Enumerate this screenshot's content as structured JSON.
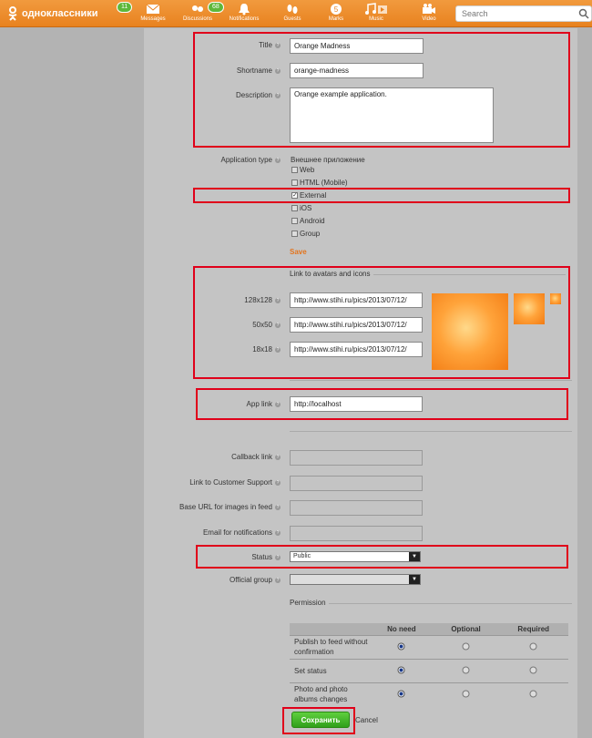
{
  "header": {
    "logo": "одноклассники",
    "logo_badge": "11",
    "nav": [
      {
        "label": "Messages",
        "icon": "envelope-icon"
      },
      {
        "label": "Discussions",
        "icon": "discussions-icon",
        "badge": "68"
      },
      {
        "label": "Notifications",
        "icon": "bell-icon"
      },
      {
        "label": "Guests",
        "icon": "footprints-icon"
      },
      {
        "label": "Marks",
        "icon": "marks-icon"
      },
      {
        "label": "Music",
        "icon": "music-icon"
      },
      {
        "label": "Video",
        "icon": "video-icon"
      }
    ],
    "search_placeholder": "Search"
  },
  "form": {
    "title_label": "Title",
    "title_value": "Orange Madness",
    "shortname_label": "Shortname",
    "shortname_value": "orange-madness",
    "description_label": "Description",
    "description_value": "Orange example application.",
    "apptype_label": "Application type",
    "apptype_heading": "Внешнее приложение",
    "apptype_options": [
      {
        "label": "Web",
        "checked": false
      },
      {
        "label": "HTML (Mobile)",
        "checked": false
      },
      {
        "label": "External",
        "checked": true
      },
      {
        "label": "iOS",
        "checked": false
      },
      {
        "label": "Android",
        "checked": false
      },
      {
        "label": "Group",
        "checked": false
      }
    ],
    "save_link": "Save",
    "avatars_heading": "Link to avatars and icons",
    "icon_128_label": "128x128",
    "icon_128_value": "http://www.stihi.ru/pics/2013/07/12/",
    "icon_50_label": "50x50",
    "icon_50_value": "http://www.stihi.ru/pics/2013/07/12/",
    "icon_18_label": "18x18",
    "icon_18_value": "http://www.stihi.ru/pics/2013/07/12/",
    "applink_label": "App link",
    "applink_value": "http://localhost",
    "callback_label": "Callback link",
    "support_label": "Link to Customer Support",
    "baseurl_label": "Base URL for images in feed",
    "email_label": "Email for notifications",
    "status_label": "Status",
    "status_value": "Public",
    "group_label": "Official group",
    "group_value": "",
    "permission_heading": "Permission",
    "perm_cols": [
      "No need",
      "Optional",
      "Required"
    ],
    "perm_rows": [
      {
        "label": "Publish to feed without confirmation",
        "selected": 0
      },
      {
        "label": "Set status",
        "selected": 0
      },
      {
        "label": "Photo and photo albums changes",
        "selected": 0
      }
    ],
    "submit_label": "Сохранить",
    "cancel_label": "Cancel"
  },
  "colors": {
    "brand": "#ee8a2b",
    "highlight": "#e0001a",
    "submit": "#3fb326"
  }
}
